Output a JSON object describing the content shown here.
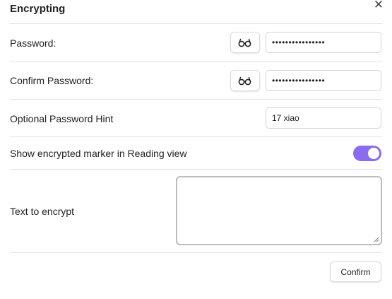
{
  "modal": {
    "title": "Encrypting",
    "close_icon": "close-icon"
  },
  "password": {
    "label": "Password:",
    "reveal_icon": "eye-glasses-icon",
    "value": "••••••••••••••••"
  },
  "confirm_password": {
    "label": "Confirm Password:",
    "reveal_icon": "eye-glasses-icon",
    "value": "••••••••••••••••"
  },
  "hint": {
    "label": "Optional Password Hint",
    "value": "17 xiao"
  },
  "marker": {
    "label": "Show encrypted marker in Reading view",
    "enabled": true,
    "accent_color": "#8b6cf0"
  },
  "text_to_encrypt": {
    "label": "Text to encrypt",
    "value": ""
  },
  "confirm_button": {
    "label": "Confirm"
  }
}
